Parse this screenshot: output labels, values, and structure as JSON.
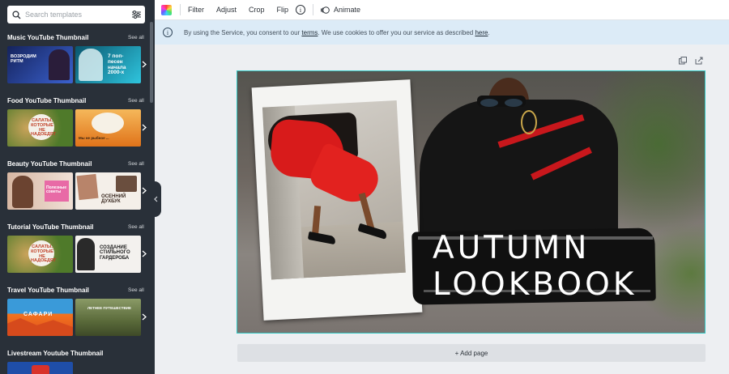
{
  "sidebar": {
    "search_placeholder": "Search templates",
    "see_all": "See all",
    "sections": [
      {
        "title": "Music YouTube Thumbnail",
        "thumbs": [
          {
            "caption": "ВОЗРОДИМ РИТМ",
            "colors": [
              "#1a2a6b",
              "#3a5ec9"
            ]
          },
          {
            "caption": "7 поп-песен начала 2000-х",
            "colors": [
              "#0e6f8c",
              "#30c6e0"
            ]
          }
        ]
      },
      {
        "title": "Food YouTube Thumbnail",
        "thumbs": [
          {
            "caption": "САЛАТЫ, КОТОРЫЕ НЕ НАДОЕДЯТ",
            "colors": [
              "#4f7a2a",
              "#9bbf4a"
            ]
          },
          {
            "caption": "Мы не рыбное ...",
            "colors": [
              "#e07a1a",
              "#f0b046"
            ]
          }
        ]
      },
      {
        "title": "Beauty YouTube Thumbnail",
        "thumbs": [
          {
            "caption": "Полезные советы",
            "colors": [
              "#7a5a46",
              "#e7c7b6"
            ]
          },
          {
            "caption": "ОСЕННИЙ ДУХБУК",
            "colors": [
              "#c8bfb6",
              "#f4efe9"
            ]
          }
        ]
      },
      {
        "title": "Tutorial YouTube Thumbnail",
        "thumbs": [
          {
            "caption": "САЛАТЫ, КОТОРЫЕ НЕ НАДОЕДЯТ",
            "colors": [
              "#4f7a2a",
              "#9bbf4a"
            ]
          },
          {
            "caption": "СОЗДАНИЕ СТИЛЬНОГО ГАРДЕРОБА",
            "colors": [
              "#d9d6d2",
              "#f3f1ee"
            ]
          }
        ]
      },
      {
        "title": "Travel YouTube Thumbnail",
        "thumbs": [
          {
            "caption": "САФАРИ",
            "colors": [
              "#f2741f",
              "#e04f1d"
            ]
          },
          {
            "caption": "ЛЕТНЕЕ ПУТЕШЕСТВИЕ",
            "colors": [
              "#5a6a3a",
              "#a8b46a"
            ]
          }
        ]
      },
      {
        "title": "Livestream Youtube Thumbnail",
        "thumbs": []
      }
    ]
  },
  "toolbar": {
    "filter": "Filter",
    "adjust": "Adjust",
    "crop": "Crop",
    "flip": "Flip",
    "info": "i",
    "animate": "Animate"
  },
  "banner": {
    "prefix": "By using the Service, you consent to our ",
    "terms": "terms",
    "middle": ". We use cookies to offer you our service as described ",
    "here": "here",
    "suffix": "."
  },
  "design": {
    "headline_line1": "AUTUMN",
    "headline_line2": "LOOKBOOK"
  },
  "add_page": "+ Add page",
  "colors": {
    "accent": "#33c8c4",
    "sidebar_bg": "#293039",
    "banner_bg": "#dcebf7"
  },
  "icons": [
    "search-icon",
    "filter-sliders-icon",
    "color-swatch-icon",
    "info-icon",
    "animate-icon",
    "duplicate-page-icon",
    "add-page-icon",
    "chevron-right-icon",
    "chevron-left-icon"
  ]
}
